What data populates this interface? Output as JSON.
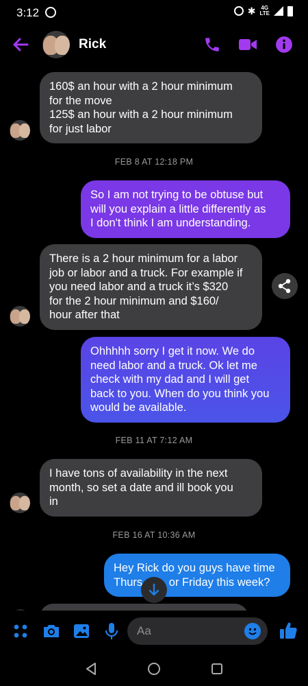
{
  "status": {
    "time": "3:12",
    "network": "4G LTE",
    "colors": {
      "status_text": "#ffffff"
    }
  },
  "header": {
    "contact_name": "Rick",
    "icons": [
      "back-arrow-icon",
      "phone-icon",
      "video-icon",
      "info-icon"
    ],
    "accent": "#a23af0"
  },
  "messages": [
    {
      "sender": "Rick",
      "direction": "in",
      "text": "160$ an hour with a 2 hour minimum for the move\n125$ an hour with a 2 hour minimum for just labor"
    },
    {
      "type": "timestamp",
      "text": "FEB 8 AT 12:18 PM"
    },
    {
      "sender": "me",
      "direction": "out",
      "text": "So I am not trying to be obtuse but will you explain a little differently as I don't think I am understanding."
    },
    {
      "sender": "Rick",
      "direction": "in",
      "text": "There is a 2 hour minimum for a labor job or labor and a truck. For example if you need labor and a truck it’s $320 for the 2 hour minimum and $160/ hour after that"
    },
    {
      "sender": "me",
      "direction": "out",
      "text": "Ohhhhh sorry I get it now. We do need labor and a truck. Ok let me check with my dad and I will get back to you. When do you think you would be available."
    },
    {
      "type": "timestamp",
      "text": "FEB 11 AT 7:12 AM"
    },
    {
      "sender": "Rick",
      "direction": "in",
      "text": "I have tons of availability in the next month, so set a date and ill book you in"
    },
    {
      "type": "timestamp",
      "text": "FEB 16 AT 10:36 AM"
    },
    {
      "sender": "me",
      "direction": "out",
      "text": "Hey Rick do you guys have time Thurs or Friday this week?"
    }
  ],
  "lines": {
    "m0": [
      "160$ an hour with a 2 hour minimum",
      "for the move",
      "125$ an hour with a 2 hour minimum",
      "for just labor"
    ],
    "t1": "FEB 8 AT 12:18 PM",
    "m2": [
      "So I am not trying to be obtuse but",
      "will you explain a little differently as",
      "I don't think I am understanding."
    ],
    "m3": [
      "There is a 2 hour minimum for a labor",
      "job or labor and a truck. For example if",
      "you need labor and a truck it’s $320",
      "for the 2 hour minimum and $160/",
      "hour after that"
    ],
    "m4": [
      "Ohhhhh sorry I get it now. We do",
      "need labor and a truck. Ok let me",
      "check with my dad and I will get",
      "back to you. When do you think you",
      "would be available."
    ],
    "t5": "FEB 11 AT 7:12 AM",
    "m6": [
      "I have tons of availability in the next",
      "month, so set a date and ill book you",
      "in"
    ],
    "t7": "FEB 16 AT 10:36 AM",
    "m8": [
      "Hey Rick do you guys have time",
      "Thurs",
      " or Friday this week?"
    ]
  },
  "composer": {
    "placeholder": "Aa",
    "icons": [
      "apps-icon",
      "camera-icon",
      "gallery-icon",
      "microphone-icon",
      "emoji-icon",
      "thumbs-up-icon"
    ]
  },
  "colors": {
    "incoming_bubble": "#3e3e40",
    "outgoing_purple": "#7a38e6",
    "outgoing_blue": "#1f7ee8",
    "accent_purple": "#a23af0",
    "composer_blue": "#1f7ee8"
  }
}
